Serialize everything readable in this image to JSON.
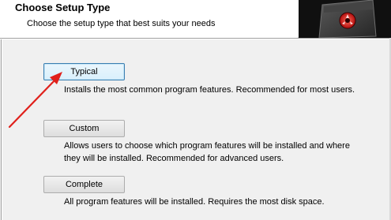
{
  "header": {
    "title": "Choose Setup Type",
    "subtitle": "Choose the setup type that best suits your needs"
  },
  "options": [
    {
      "label": "Typical",
      "description": "Installs the most common program features. Recommended for most users."
    },
    {
      "label": "Custom",
      "description_line1": "Allows users to choose which program features will be installed and where",
      "description_line2": "they will be installed. Recommended for advanced users."
    },
    {
      "label": "Complete",
      "description": "All program features will be installed. Requires the most disk space."
    }
  ],
  "icons": {
    "header_graphic": "installer-box-icon",
    "annotation": "red-arrow-icon"
  },
  "colors": {
    "accent_red": "#e0201b",
    "focus_border": "#3c7fb1"
  }
}
